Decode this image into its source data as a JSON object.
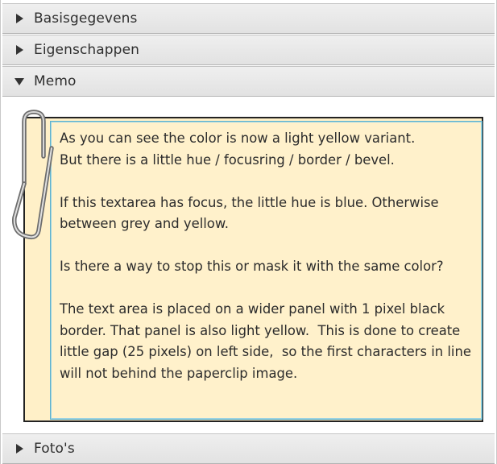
{
  "accordion": {
    "panes": [
      {
        "label": "Basisgegevens",
        "expanded": false,
        "icon": "arrow-right-icon"
      },
      {
        "label": "Eigenschappen",
        "expanded": false,
        "icon": "arrow-right-icon"
      },
      {
        "label": "Memo",
        "expanded": true,
        "icon": "arrow-down-icon"
      },
      {
        "label": "Foto's",
        "expanded": false,
        "icon": "arrow-right-icon"
      }
    ]
  },
  "memo": {
    "panel_color": "#fff0c8",
    "focus_ring_color": "#5fb2cc",
    "lines": [
      "As you can see the color is now a light yellow variant.",
      "But there is a little hue / focusring / border / bevel.",
      "",
      "If this textarea has focus, the little hue is blue. Otherwise",
      "between grey and yellow.",
      "",
      "Is there a way to stop this or mask it with the same color?",
      "",
      "The text area is placed on a wider panel with 1 pixel black",
      "border. That panel is also light yellow.  This is done to create",
      "little gap (25 pixels) on left side,  so the first characters in line",
      "will not behind the paperclip image."
    ]
  }
}
